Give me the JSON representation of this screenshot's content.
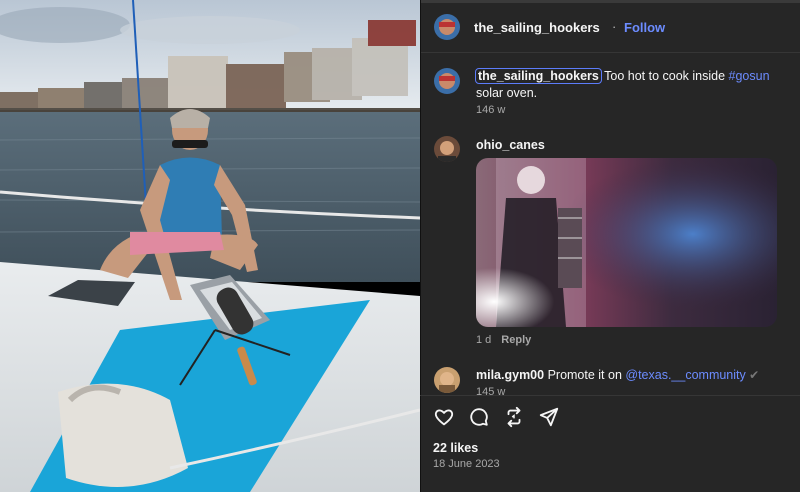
{
  "post": {
    "username": "the_sailing_hookers",
    "follow_label": "Follow",
    "separator": "·",
    "caption_user": "the_sailing_hookers",
    "caption_pre": " Too hot to cook inside ",
    "caption_tag": "#gosun",
    "caption_post": " solar oven.",
    "caption_age": "146 w"
  },
  "comments": [
    {
      "username": "ohio_canes",
      "age": "1 d",
      "reply_label": "Reply"
    },
    {
      "username": "mila.gym00",
      "text_pre": " Promote it on ",
      "mention": "@texas.__community",
      "text_post": " ✔",
      "age": "145 w"
    }
  ],
  "actions": {
    "icons": [
      "heart-icon",
      "comment-icon",
      "repost-icon",
      "share-icon"
    ]
  },
  "stats": {
    "likes": "22 likes",
    "date": "18 June 2023"
  },
  "colors": {
    "accent": "#6c8cff",
    "panel_bg": "#262626",
    "mat": "#1aa5d8"
  }
}
